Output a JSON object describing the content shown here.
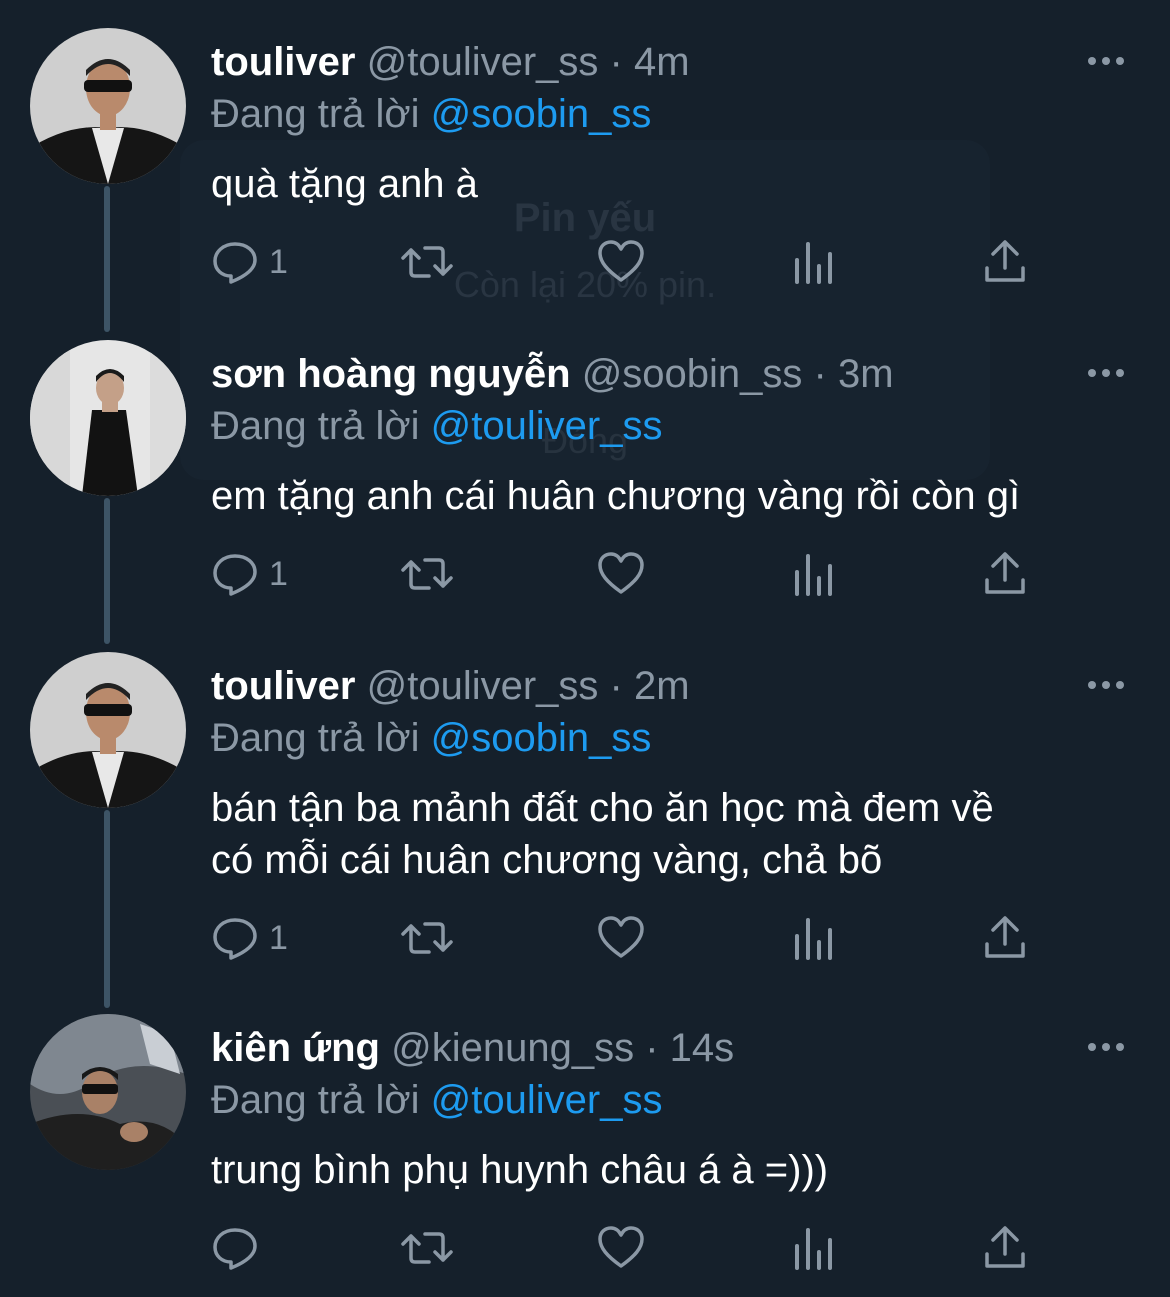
{
  "app": {
    "accent": "#1d9bf0",
    "background": "#15202b",
    "muted": "#8b98a5"
  },
  "overlay": {
    "title": "Pin yếu",
    "message": "Còn lại 20% pin.",
    "button": "Đóng"
  },
  "tweets": [
    {
      "name": "touliver",
      "handle": "@touliver_ss",
      "dot": "·",
      "time": "4m",
      "reply_prefix": "Đang trả lời",
      "reply_to": "@soobin_ss",
      "text": "quà tặng anh à",
      "reply_count": "1",
      "avatar": "avatar-touliver"
    },
    {
      "name": "sơn hoàng nguyễn",
      "handle": "@soobin_ss",
      "dot": "·",
      "time": "3m",
      "reply_prefix": "Đang trả lời",
      "reply_to": "@touliver_ss",
      "text": "em tặng anh cái huân chương vàng rồi còn gì",
      "reply_count": "1",
      "avatar": "avatar-soobin"
    },
    {
      "name": "touliver",
      "handle": "@touliver_ss",
      "dot": "·",
      "time": "2m",
      "reply_prefix": "Đang trả lời",
      "reply_to": "@soobin_ss",
      "text": "bán tận ba mảnh đất cho ăn học mà đem về\ncó mỗi cái huân chương vàng, chả bõ",
      "reply_count": "1",
      "avatar": "avatar-touliver"
    },
    {
      "name": "kiên ứng",
      "handle": "@kienung_ss",
      "dot": "·",
      "time": "14s",
      "reply_prefix": "Đang trả lời",
      "reply_to": "@touliver_ss",
      "text": "trung bình phụ huynh châu á à =)))",
      "reply_count": "",
      "avatar": "avatar-kienung"
    }
  ],
  "icons": {
    "reply": "speech-bubble-icon",
    "retweet": "retweet-arrows-icon",
    "like": "heart-icon",
    "views": "bar-chart-icon",
    "share": "share-upload-icon",
    "more": "ellipsis-icon"
  }
}
